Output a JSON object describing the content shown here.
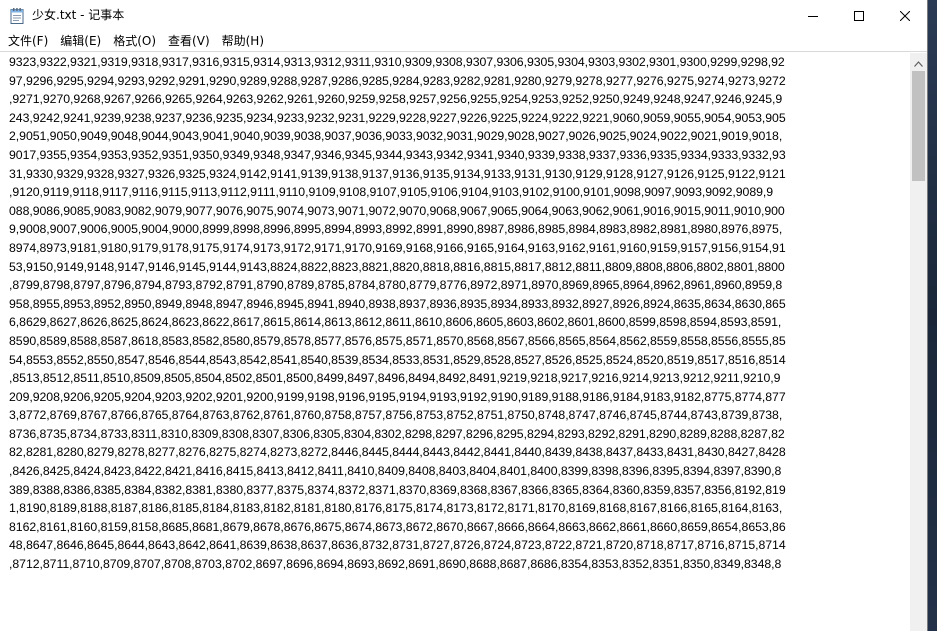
{
  "window": {
    "title": "少女.txt - 记事本",
    "controls": {
      "minimize": "minimize-icon",
      "maximize": "maximize-icon",
      "close": "close-icon"
    }
  },
  "menu": [
    {
      "label": "文件(F)"
    },
    {
      "label": "编辑(E)"
    },
    {
      "label": "格式(O)"
    },
    {
      "label": "查看(V)"
    },
    {
      "label": "帮助(H)"
    }
  ],
  "editor": {
    "lines": [
      "9323,9322,9321,9319,9318,9317,9316,9315,9314,9313,9312,9311,9310,9309,9308,9307,9306,9305,9304,9303,9302,9301,9300,9299,9298,92",
      "97,9296,9295,9294,9293,9292,9291,9290,9289,9288,9287,9286,9285,9284,9283,9282,9281,9280,9279,9278,9277,9276,9275,9274,9273,9272",
      ",9271,9270,9268,9267,9266,9265,9264,9263,9262,9261,9260,9259,9258,9257,9256,9255,9254,9253,9252,9250,9249,9248,9247,9246,9245,9",
      "243,9242,9241,9239,9238,9237,9236,9235,9234,9233,9232,9231,9229,9228,9227,9226,9225,9224,9222,9221,9060,9059,9055,9054,9053,905",
      "2,9051,9050,9049,9048,9044,9043,9041,9040,9039,9038,9037,9036,9033,9032,9031,9029,9028,9027,9026,9025,9024,9022,9021,9019,9018,",
      "9017,9355,9354,9353,9352,9351,9350,9349,9348,9347,9346,9345,9344,9343,9342,9341,9340,9339,9338,9337,9336,9335,9334,9333,9332,93",
      "31,9330,9329,9328,9327,9326,9325,9324,9142,9141,9139,9138,9137,9136,9135,9134,9133,9131,9130,9129,9128,9127,9126,9125,9122,9121",
      ",9120,9119,9118,9117,9116,9115,9113,9112,9111,9110,9109,9108,9107,9105,9106,9104,9103,9102,9100,9101,9098,9097,9093,9092,9089,9",
      "088,9086,9085,9083,9082,9079,9077,9076,9075,9074,9073,9071,9072,9070,9068,9067,9065,9064,9063,9062,9061,9016,9015,9011,9010,900",
      "9,9008,9007,9006,9005,9004,9000,8999,8998,8996,8995,8994,8993,8992,8991,8990,8987,8986,8985,8984,8983,8982,8981,8980,8976,8975,",
      "8974,8973,9181,9180,9179,9178,9175,9174,9173,9172,9171,9170,9169,9168,9166,9165,9164,9163,9162,9161,9160,9159,9157,9156,9154,91",
      "53,9150,9149,9148,9147,9146,9145,9144,9143,8824,8822,8823,8821,8820,8818,8816,8815,8817,8812,8811,8809,8808,8806,8802,8801,8800",
      ",8799,8798,8797,8796,8794,8793,8792,8791,8790,8789,8785,8784,8780,8779,8776,8972,8971,8970,8969,8965,8964,8962,8961,8960,8959,8",
      "958,8955,8953,8952,8950,8949,8948,8947,8946,8945,8941,8940,8938,8937,8936,8935,8934,8933,8932,8927,8926,8924,8635,8634,8630,865",
      "6,8629,8627,8626,8625,8624,8623,8622,8617,8615,8614,8613,8612,8611,8610,8606,8605,8603,8602,8601,8600,8599,8598,8594,8593,8591,",
      "8590,8589,8588,8587,8618,8583,8582,8580,8579,8578,8577,8576,8575,8571,8570,8568,8567,8566,8565,8564,8562,8559,8558,8556,8555,85",
      "54,8553,8552,8550,8547,8546,8544,8543,8542,8541,8540,8539,8534,8533,8531,8529,8528,8527,8526,8525,8524,8520,8519,8517,8516,8514",
      ",8513,8512,8511,8510,8509,8505,8504,8502,8501,8500,8499,8497,8496,8494,8492,8491,9219,9218,9217,9216,9214,9213,9212,9211,9210,9",
      "209,9208,9206,9205,9204,9203,9202,9201,9200,9199,9198,9196,9195,9194,9193,9192,9190,9189,9188,9186,9184,9183,9182,8775,8774,877",
      "3,8772,8769,8767,8766,8765,8764,8763,8762,8761,8760,8758,8757,8756,8753,8752,8751,8750,8748,8747,8746,8745,8744,8743,8739,8738,",
      "8736,8735,8734,8733,8311,8310,8309,8308,8307,8306,8305,8304,8302,8298,8297,8296,8295,8294,8293,8292,8291,8290,8289,8288,8287,82",
      "82,8281,8280,8279,8278,8277,8276,8275,8274,8273,8272,8446,8445,8444,8443,8442,8441,8440,8439,8438,8437,8433,8431,8430,8427,8428",
      ",8426,8425,8424,8423,8422,8421,8416,8415,8413,8412,8411,8410,8409,8408,8403,8404,8401,8400,8399,8398,8396,8395,8394,8397,8390,8",
      "389,8388,8386,8385,8384,8382,8381,8380,8377,8375,8374,8372,8371,8370,8369,8368,8367,8366,8365,8364,8360,8359,8357,8356,8192,819",
      "1,8190,8189,8188,8187,8186,8185,8184,8183,8182,8181,8180,8176,8175,8174,8173,8172,8171,8170,8169,8168,8167,8166,8165,8164,8163,",
      "8162,8161,8160,8159,8158,8685,8681,8679,8678,8676,8675,8674,8673,8672,8670,8667,8666,8664,8663,8662,8661,8660,8659,8654,8653,86",
      "48,8647,8646,8645,8644,8643,8642,8641,8639,8638,8637,8636,8732,8731,8727,8726,8724,8723,8722,8721,8720,8718,8717,8716,8715,8714",
      ",8712,8711,8710,8709,8707,8708,8703,8702,8697,8696,8694,8693,8692,8691,8690,8688,8687,8686,8354,8353,8352,8351,8350,8349,8348,8"
    ]
  },
  "scrollbar": {
    "up_icon": "chevron-up-icon"
  }
}
